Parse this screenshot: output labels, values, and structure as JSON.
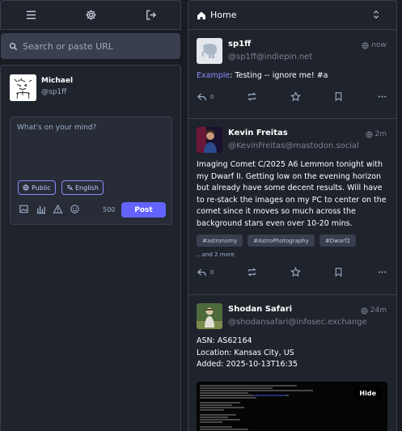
{
  "nav": {
    "icons": [
      "menu-icon",
      "gear-icon",
      "logout-icon"
    ]
  },
  "search": {
    "placeholder": "Search or paste URL"
  },
  "account": {
    "display_name": "Michael",
    "handle": "@sp1ff"
  },
  "composer": {
    "placeholder": "What's on your mind?",
    "visibility_label": "Public",
    "language_label": "English",
    "char_count": "500",
    "post_label": "Post"
  },
  "column": {
    "title": "Home"
  },
  "colors": {
    "accent": "#6364ff",
    "link": "#8c8dff",
    "background": "#191b22",
    "panel": "#1f232b"
  },
  "statuses": [
    {
      "display_name": "sp1ff",
      "handle": "@sp1ff@indiepin.net",
      "time": "now",
      "link_text": "Example",
      "text": ": Testing -- ignore me! #a",
      "reply_count": "0"
    },
    {
      "display_name": "Kevin Freitas",
      "handle": "@KevinFreitas@mastodon.social",
      "time": "2m",
      "text": "Imaging Comet C/2025 A6 Lemmon tonight with my Dwarf II. Getting low on the evening horizon but already have some decent results. Will have to re-stack the images on my PC to center on the comet since it moves so much across the background stars even over 10-20 mins.",
      "tags": [
        "#astronomy",
        "#AstroPhotography",
        "#Dwarf2"
      ],
      "more_tags": "...and 2 more",
      "reply_count": "0"
    },
    {
      "display_name": "Shodan Safari",
      "handle": "@shodansafari@infosec.exchange",
      "time": "24m",
      "lines": [
        "ASN: AS62164",
        "Location: Kansas City, US",
        "Added: 2025-10-13T16:35"
      ],
      "hide_label": "Hide"
    }
  ]
}
